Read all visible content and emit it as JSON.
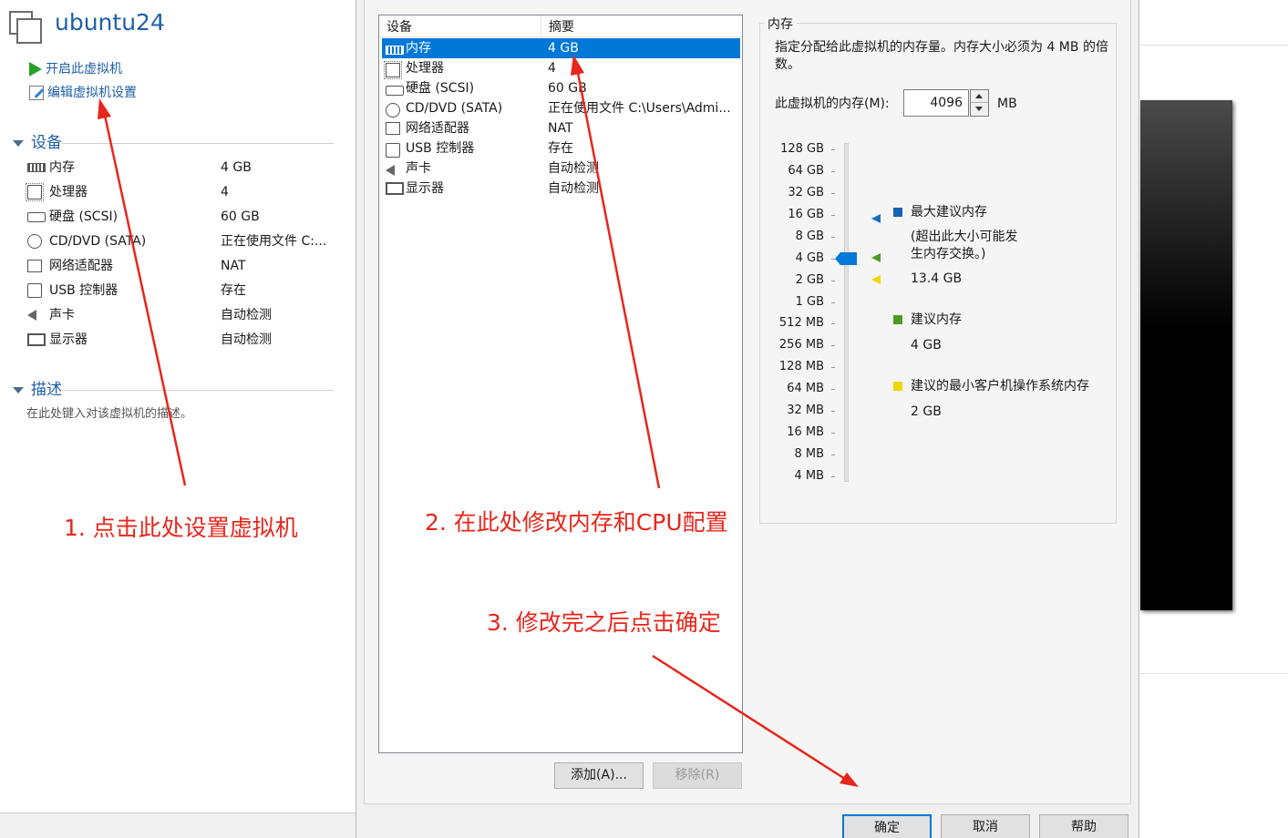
{
  "vm": {
    "title": "ubuntu24",
    "actions": {
      "start": "开启此虚拟机",
      "edit": "编辑虚拟机设置"
    },
    "devices_section": "设备",
    "devices": [
      {
        "name": "内存",
        "value": "4 GB",
        "icon": "memory-icon"
      },
      {
        "name": "处理器",
        "value": "4",
        "icon": "processor-icon"
      },
      {
        "name": "硬盘 (SCSI)",
        "value": "60 GB",
        "icon": "hard-disk-icon"
      },
      {
        "name": "CD/DVD (SATA)",
        "value": "正在使用文件 C:...",
        "icon": "cd-dvd-icon"
      },
      {
        "name": "网络适配器",
        "value": "NAT",
        "icon": "network-adapter-icon"
      },
      {
        "name": "USB 控制器",
        "value": "存在",
        "icon": "usb-icon"
      },
      {
        "name": "声卡",
        "value": "自动检测",
        "icon": "sound-card-icon"
      },
      {
        "name": "显示器",
        "value": "自动检测",
        "icon": "display-icon"
      }
    ],
    "desc_section": "描述",
    "desc_placeholder": "在此处键入对该虚拟机的描述。"
  },
  "dialog": {
    "list_headers": {
      "device": "设备",
      "summary": "摘要"
    },
    "list": [
      {
        "name": "内存",
        "value": "4 GB",
        "selected": true
      },
      {
        "name": "处理器",
        "value": "4"
      },
      {
        "name": "硬盘 (SCSI)",
        "value": "60 GB"
      },
      {
        "name": "CD/DVD (SATA)",
        "value": "正在使用文件 C:\\Users\\Admi..."
      },
      {
        "name": "网络适配器",
        "value": "NAT"
      },
      {
        "name": "USB 控制器",
        "value": "存在"
      },
      {
        "name": "声卡",
        "value": "自动检测"
      },
      {
        "name": "显示器",
        "value": "自动检测"
      }
    ],
    "add_button": "添加(A)...",
    "remove_button": "移除(R)",
    "memory": {
      "group_label": "内存",
      "description": "指定分配给此虚拟机的内存量。内存大小必须为 4 MB 的倍数。",
      "input_label": "此虚拟机的内存(M):",
      "value": "4096",
      "unit": "MB",
      "scale": [
        "128 GB",
        "64 GB",
        "32 GB",
        "16 GB",
        "8 GB",
        "4 GB",
        "2 GB",
        "1 GB",
        "512 MB",
        "256 MB",
        "128 MB",
        "64 MB",
        "32 MB",
        "16 MB",
        "8 MB",
        "4 MB"
      ],
      "legend": {
        "max_title": "最大建议内存",
        "max_note": "(超出此大小可能发生内存交换。)",
        "max_value": "13.4 GB",
        "rec_title": "建议内存",
        "rec_value": "4 GB",
        "min_title": "建议的最小客户机操作系统内存",
        "min_value": "2 GB"
      },
      "colors": {
        "max": "#1763b5",
        "recommended": "#4e9a25",
        "minimum": "#f2d600",
        "slider": "#0078d7"
      }
    },
    "buttons": {
      "ok": "确定",
      "cancel": "取消",
      "help": "帮助"
    }
  },
  "annotations": {
    "step1": "1. 点击此处设置虚拟机",
    "step2": "2. 在此处修改内存和CPU配置",
    "step3": "3. 修改完之后点击确定",
    "color": "#e8261c"
  }
}
